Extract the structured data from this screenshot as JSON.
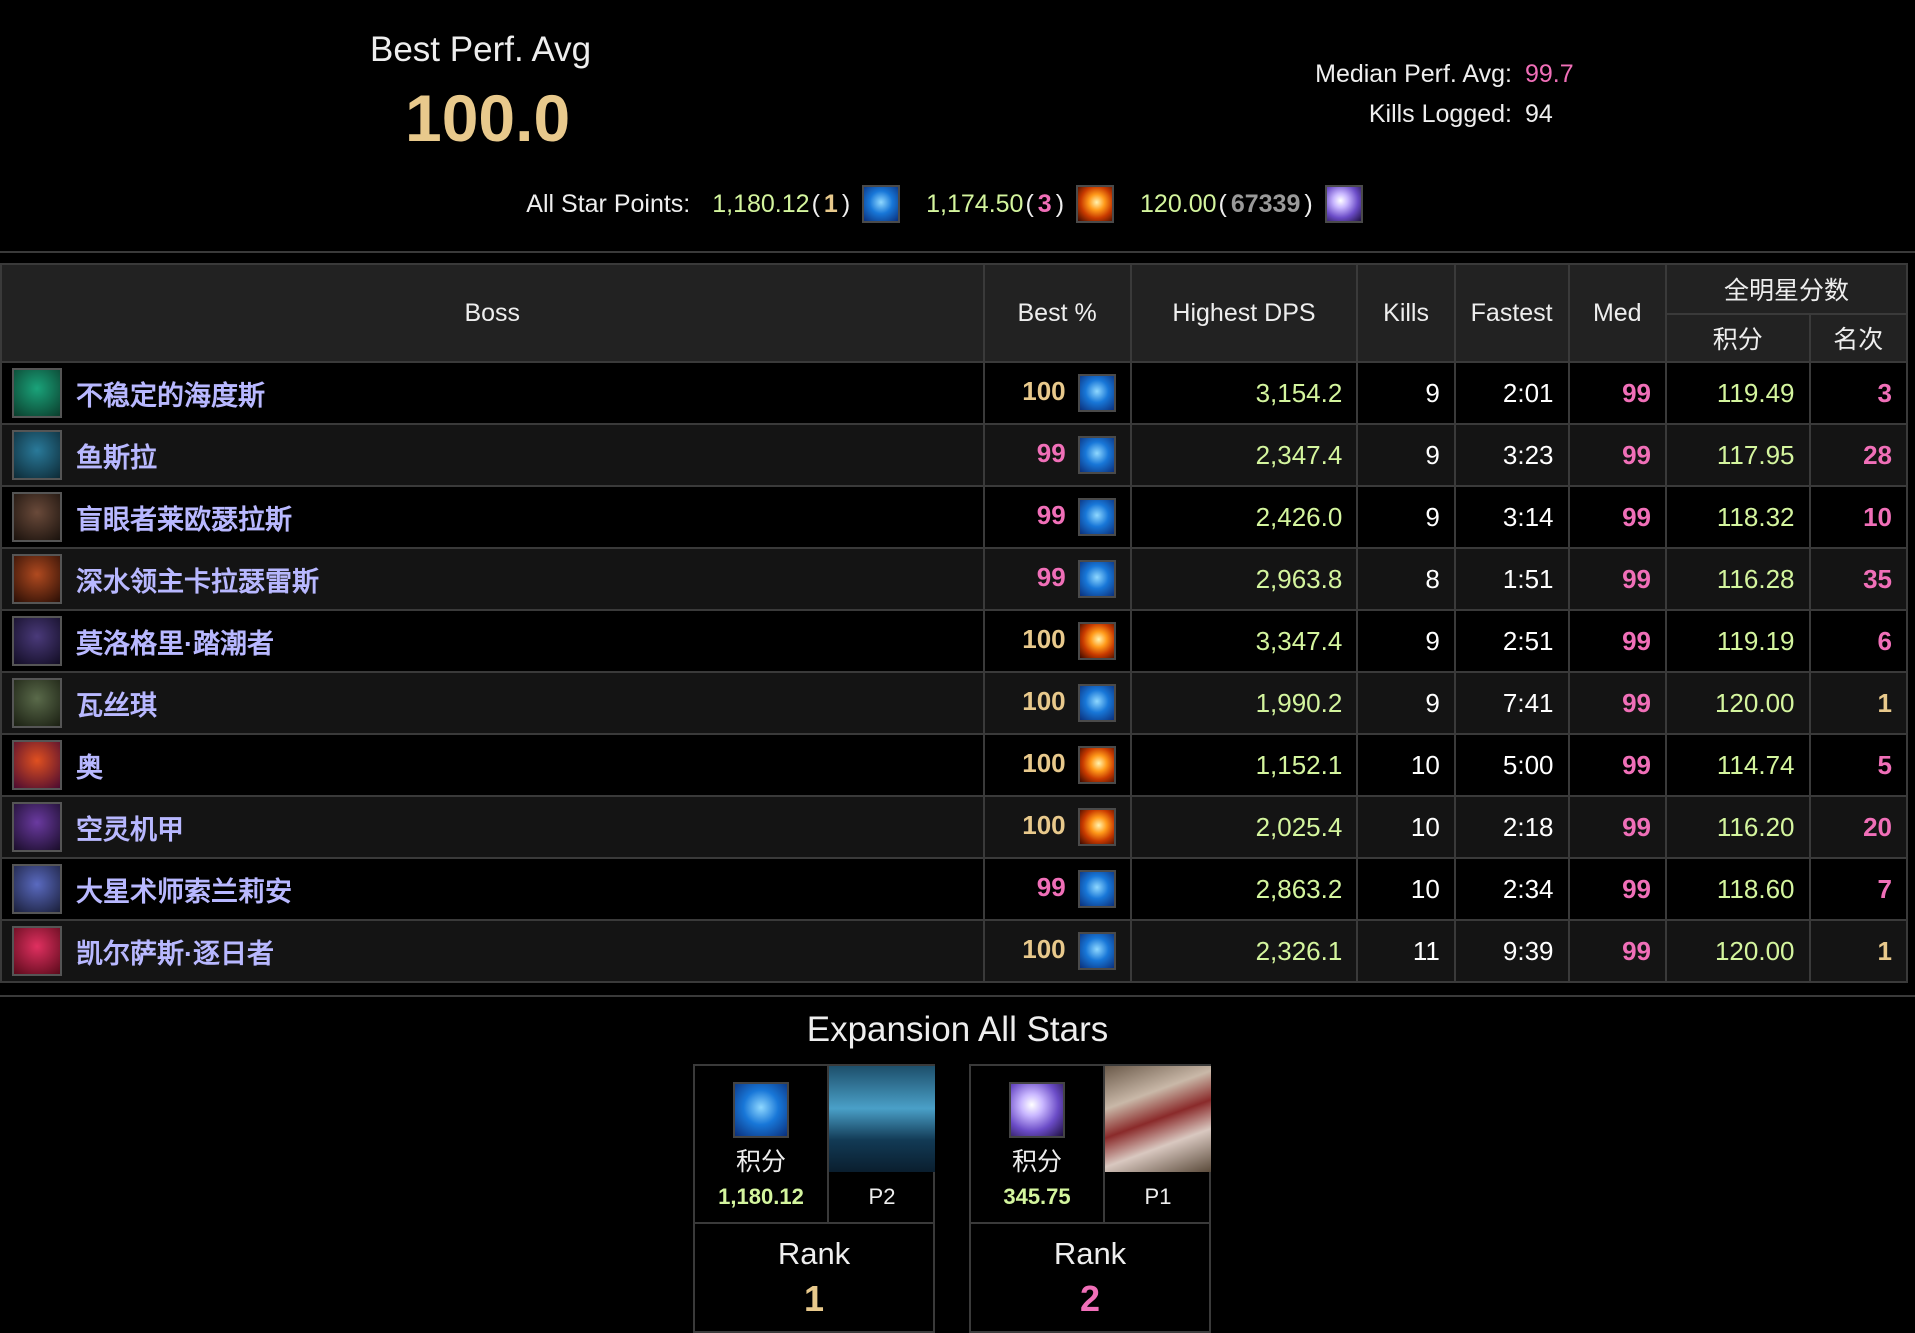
{
  "header": {
    "best_title": "Best Perf. Avg",
    "best_value": "100.0",
    "median_label": "Median Perf. Avg:",
    "median_value": "99.7",
    "kills_label": "Kills Logged:",
    "kills_value": "94"
  },
  "all_star": {
    "label": "All Star Points:",
    "entries": [
      {
        "points": "1,180.12",
        "rank": "1",
        "icon": "water-icon",
        "rank_color": "#e8c98c"
      },
      {
        "points": "1,174.50",
        "rank": "3",
        "icon": "fire-icon",
        "rank_color": "#f06fb8"
      },
      {
        "points": "120.00",
        "rank": "67339",
        "icon": "arcane-icon",
        "rank_color": "#9a9a9a"
      }
    ]
  },
  "table": {
    "headers": {
      "boss": "Boss",
      "best": "Best %",
      "dps": "Highest DPS",
      "kills": "Kills",
      "fastest": "Fastest",
      "med": "Med",
      "allstar_group": "全明星分数",
      "points": "积分",
      "rank": "名次"
    },
    "rows": [
      {
        "boss": "不稳定的海度斯",
        "best": "100",
        "icon": "water-icon",
        "dps": "3,154.2",
        "kills": "9",
        "fastest": "2:01",
        "med": "99",
        "points": "119.49",
        "rank": "3"
      },
      {
        "boss": "鱼斯拉",
        "best": "99",
        "icon": "water-icon",
        "dps": "2,347.4",
        "kills": "9",
        "fastest": "3:23",
        "med": "99",
        "points": "117.95",
        "rank": "28"
      },
      {
        "boss": "盲眼者莱欧瑟拉斯",
        "best": "99",
        "icon": "water-icon",
        "dps": "2,426.0",
        "kills": "9",
        "fastest": "3:14",
        "med": "99",
        "points": "118.32",
        "rank": "10"
      },
      {
        "boss": "深水领主卡拉瑟雷斯",
        "best": "99",
        "icon": "water-icon",
        "dps": "2,963.8",
        "kills": "8",
        "fastest": "1:51",
        "med": "99",
        "points": "116.28",
        "rank": "35"
      },
      {
        "boss": "莫洛格里·踏潮者",
        "best": "100",
        "icon": "fire-icon",
        "dps": "3,347.4",
        "kills": "9",
        "fastest": "2:51",
        "med": "99",
        "points": "119.19",
        "rank": "6"
      },
      {
        "boss": "瓦丝琪",
        "best": "100",
        "icon": "water-icon",
        "dps": "1,990.2",
        "kills": "9",
        "fastest": "7:41",
        "med": "99",
        "points": "120.00",
        "rank": "1"
      },
      {
        "boss": "奥",
        "best": "100",
        "icon": "fire-icon",
        "dps": "1,152.1",
        "kills": "10",
        "fastest": "5:00",
        "med": "99",
        "points": "114.74",
        "rank": "5"
      },
      {
        "boss": "空灵机甲",
        "best": "100",
        "icon": "fire-icon",
        "dps": "2,025.4",
        "kills": "10",
        "fastest": "2:18",
        "med": "99",
        "points": "116.20",
        "rank": "20"
      },
      {
        "boss": "大星术师索兰莉安",
        "best": "99",
        "icon": "water-icon",
        "dps": "2,863.2",
        "kills": "10",
        "fastest": "2:34",
        "med": "99",
        "points": "118.60",
        "rank": "7"
      },
      {
        "boss": "凯尔萨斯·逐日者",
        "best": "100",
        "icon": "water-icon",
        "dps": "2,326.1",
        "kills": "11",
        "fastest": "9:39",
        "med": "99",
        "points": "120.00",
        "rank": "1"
      }
    ]
  },
  "expansion": {
    "title": "Expansion All Stars",
    "cards": [
      {
        "label": "积分",
        "points": "1,180.12",
        "phase": "P2",
        "rank_label": "Rank",
        "rank": "1",
        "icon": "water-icon",
        "rank_color": "#e8c98c"
      },
      {
        "label": "积分",
        "points": "345.75",
        "phase": "P1",
        "rank_label": "Rank",
        "rank": "2",
        "icon": "arcane-icon",
        "rank_color": "#f06fb8"
      }
    ]
  },
  "colors": {
    "gold": "#e8c98c",
    "green": "#d4f59e",
    "pink": "#f06fb8",
    "boss_name": "#b8b8ff"
  }
}
